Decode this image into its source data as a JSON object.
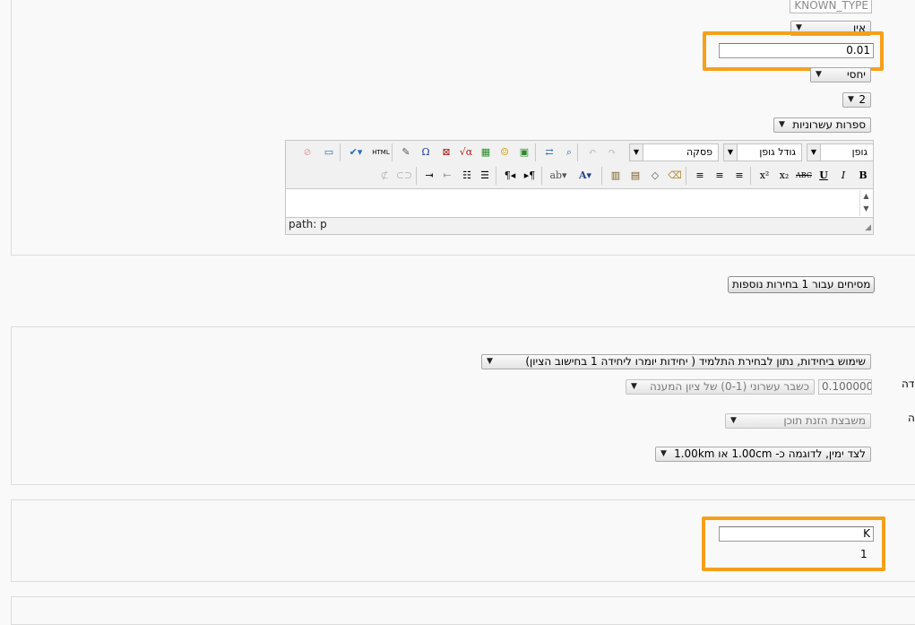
{
  "top": {
    "known_type_value": "KNOWN_TYPE",
    "select_ein": "אין",
    "decimal_input": "0.01",
    "select_relative": "יחסי",
    "select_digits": "2",
    "select_significant": "ספרות עשרוניות"
  },
  "editor": {
    "font_select": "גופן",
    "size_select": "גודל גופן",
    "format_select": "פסקה",
    "path_label": "path: p",
    "btn_bold": "B",
    "btn_italic": "I",
    "btn_underline": "U",
    "btn_strike": "ABC",
    "btn_html": "HTML"
  },
  "blanks_button": "מסיחים עבור 1 בחירות נוספות",
  "units": {
    "usage_select": "שימוש ביחידות, נתון לבחירת התלמיד ( יחידות יומרו ליחידה 1 בחישוב הציון)",
    "penalty_input": "0.1000000",
    "penalty_select": "כשבר עשרוני (0-1) של ציון המענה",
    "input_method_select": "משבצת הזנת תוכן",
    "position_select": "לצד ימין, לדוגמה כ- 1.00cm או 1.00km",
    "cut_label_1": "דה",
    "cut_label_2": "ה"
  },
  "unit_row": {
    "unit_input": "K",
    "multiplier": "1"
  },
  "colors": {
    "highlight": "#f5a01a",
    "background": "#f9f9f9"
  }
}
